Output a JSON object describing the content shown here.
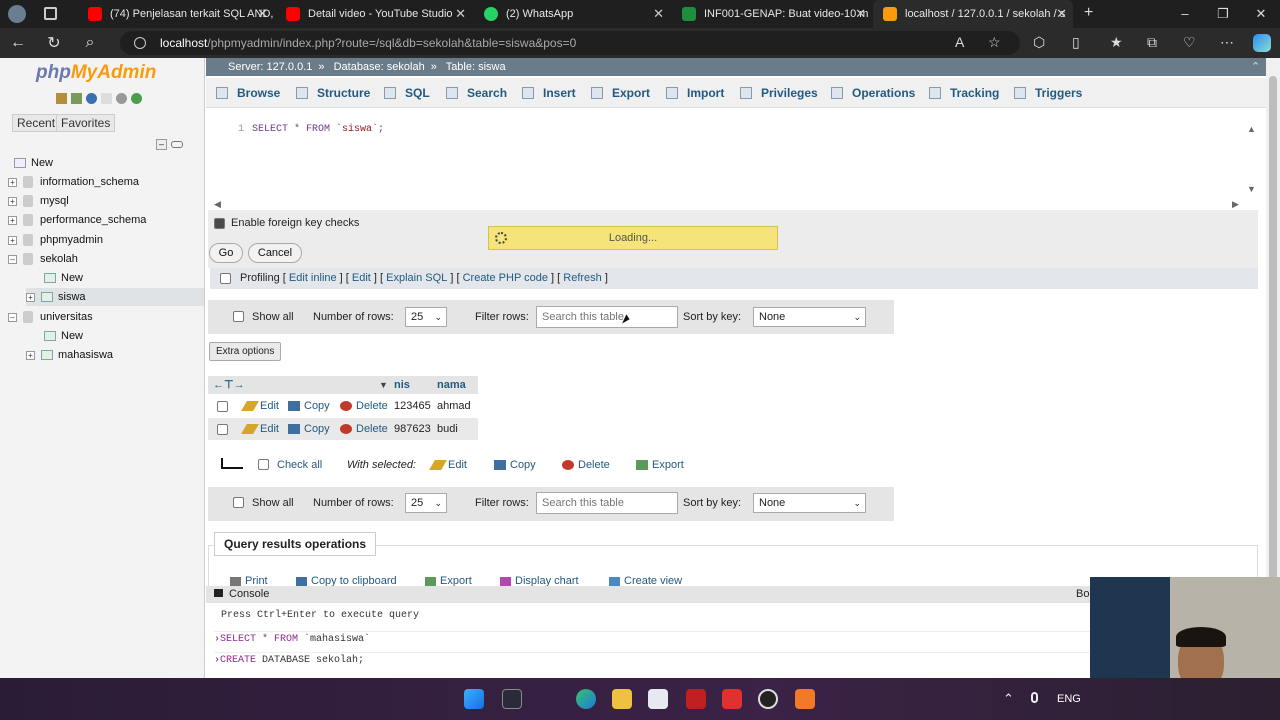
{
  "browser": {
    "tabs": [
      {
        "title": "(74) Penjelasan terkait SQL AND,",
        "icon": "youtube-icon",
        "color": "#ff0000"
      },
      {
        "title": "Detail video - YouTube Studio",
        "icon": "youtube-icon",
        "color": "#ff0000"
      },
      {
        "title": "(2) WhatsApp",
        "icon": "whatsapp-icon",
        "color": "#25d366"
      },
      {
        "title": "INF001-GENAP: Buat video-10 m",
        "icon": "classroom-icon",
        "color": "#1e8e3e"
      },
      {
        "title": "localhost / 127.0.0.1 / sekolah / s",
        "icon": "phpmyadmin-icon",
        "color": "#f89c0e"
      }
    ],
    "url_host": "localhost",
    "url_path": "/phpmyadmin/index.php?route=/sql&db=sekolah&table=siswa&pos=0"
  },
  "sidebar": {
    "logo_php": "php",
    "logo_myadmin": "MyAdmin",
    "recent": "Recent",
    "favorites": "Favorites",
    "tree": [
      {
        "label": "New",
        "kind": "new"
      },
      {
        "label": "information_schema",
        "kind": "db"
      },
      {
        "label": "mysql",
        "kind": "db"
      },
      {
        "label": "performance_schema",
        "kind": "db"
      },
      {
        "label": "phpmyadmin",
        "kind": "db"
      },
      {
        "label": "sekolah",
        "kind": "db-open"
      },
      {
        "label": "New",
        "kind": "child-new"
      },
      {
        "label": "siswa",
        "kind": "child-table"
      },
      {
        "label": "universitas",
        "kind": "db-open"
      },
      {
        "label": "New",
        "kind": "child-new"
      },
      {
        "label": "mahasiswa",
        "kind": "child-table"
      }
    ]
  },
  "breadcrumb": {
    "server": "Server: 127.0.0.1",
    "database": "Database: sekolah",
    "table": "Table: siswa"
  },
  "tabs": [
    "Browse",
    "Structure",
    "SQL",
    "Search",
    "Insert",
    "Export",
    "Import",
    "Privileges",
    "Operations",
    "Tracking",
    "Triggers"
  ],
  "editor": {
    "line_number": "1",
    "sql_kw": "SELECT * FROM ",
    "sql_table": "`siswa`",
    "sql_end": ";"
  },
  "controls": {
    "fk_label": "Enable foreign key checks",
    "go": "Go",
    "cancel": "Cancel",
    "loading": "Loading...",
    "profiling": "Profiling",
    "profiling_links": [
      "Edit inline",
      "Edit",
      "Explain SQL",
      "Create PHP code",
      "Refresh"
    ]
  },
  "navpanel": {
    "show_all": "Show all",
    "number_of_rows": "Number of rows:",
    "rows_value": "25",
    "filter_rows": "Filter rows:",
    "filter_placeholder": "Search this table",
    "sort_by_key": "Sort by key:",
    "sort_value": "None"
  },
  "results": {
    "extra_options": "Extra options",
    "columns": [
      "nis",
      "nama"
    ],
    "rows": [
      {
        "nis": "123465",
        "nama": "ahmad"
      },
      {
        "nis": "987623",
        "nama": "budi"
      }
    ],
    "edit": "Edit",
    "copy": "Copy",
    "delete": "Delete",
    "check_all": "Check all",
    "with_selected": "With selected:",
    "export": "Export"
  },
  "query_ops": {
    "title": "Query results operations",
    "items": [
      "Print",
      "Copy to clipboard",
      "Export",
      "Display chart",
      "Create view"
    ]
  },
  "console": {
    "title": "Console",
    "right": "Bo",
    "hint": "Press Ctrl+Enter to execute query",
    "line1_kw": "SELECT * FROM ",
    "line1_rest": "`mahasiswa`",
    "line2_kw": "CREATE ",
    "line2_rest": "DATABASE sekolah;"
  },
  "taskbar": {
    "lang": "ENG"
  }
}
